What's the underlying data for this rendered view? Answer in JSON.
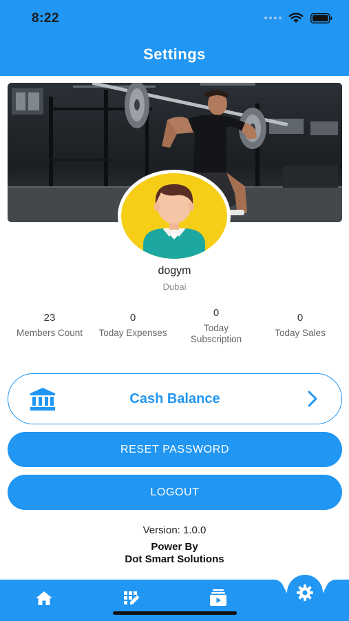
{
  "status_bar": {
    "time": "8:22"
  },
  "header": {
    "title": "Settings"
  },
  "profile": {
    "name": "dogym",
    "city": "Dubai"
  },
  "stats": [
    {
      "value": "23",
      "label": "Members Count"
    },
    {
      "value": "0",
      "label": "Today Expenses"
    },
    {
      "value": "0",
      "label": "Today Subscription"
    },
    {
      "value": "0",
      "label": "Today Sales"
    }
  ],
  "cash_balance": {
    "label": "Cash Balance"
  },
  "buttons": {
    "reset_password": "RESET PASSWORD",
    "logout": "LOGOUT"
  },
  "footer": {
    "version": "Version: 1.0.0",
    "power_by": "Power By",
    "company": "Dot Smart Solutions"
  },
  "bottom_nav": {
    "items": [
      "home-icon",
      "grid-edit-icon",
      "video-stack-icon",
      "settings-gear-icon"
    ],
    "active": "settings-gear-icon"
  },
  "colors": {
    "primary": "#2196F3",
    "avatar_bg": "#F6CE18",
    "white": "#FFFFFF"
  }
}
